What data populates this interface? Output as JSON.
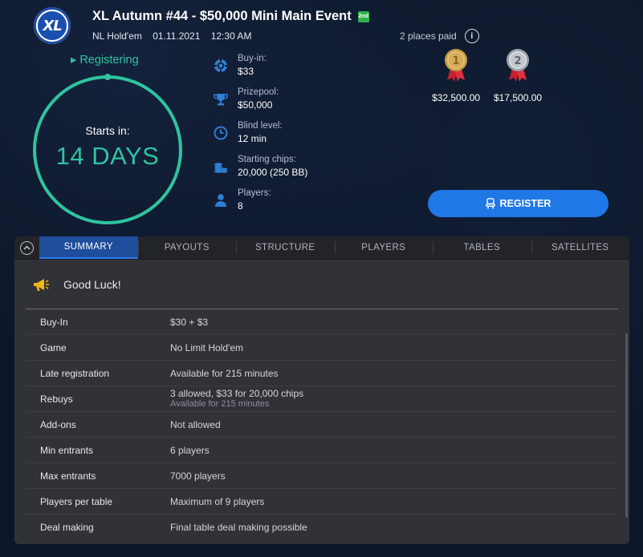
{
  "header": {
    "logo_text": "XL",
    "title": "XL Autumn #44 - $50,000 Mini Main Event",
    "badge": "2nd",
    "game": "NL Hold'em",
    "date": "01.11.2021",
    "time": "12:30 AM"
  },
  "status": {
    "label": "Registering",
    "countdown_label": "Starts in:",
    "countdown_value": "14 DAYS",
    "color": "#2ec4a0"
  },
  "info": [
    {
      "label": "Buy-in:",
      "value": "$33",
      "icon": "chip-icon"
    },
    {
      "label": "Prizepool:",
      "value": "$50,000",
      "icon": "trophy-icon"
    },
    {
      "label": "Blind level:",
      "value": "12 min",
      "icon": "clock-icon"
    },
    {
      "label": "Starting chips:",
      "value": "20,000 (250 BB)",
      "icon": "chip-stack-icon"
    },
    {
      "label": "Players:",
      "value": "8",
      "icon": "user-icon"
    }
  ],
  "places": {
    "text": "2 places paid",
    "prizes": [
      {
        "place": "1",
        "amount": "$32,500.00",
        "medal": "gold"
      },
      {
        "place": "2",
        "amount": "$17,500.00",
        "medal": "silver"
      }
    ]
  },
  "register_button": "REGISTER",
  "accent_color": "#1f78e6",
  "tabs": [
    {
      "label": "SUMMARY",
      "active": true
    },
    {
      "label": "PAYOUTS",
      "active": false
    },
    {
      "label": "STRUCTURE",
      "active": false
    },
    {
      "label": "PLAYERS",
      "active": false
    },
    {
      "label": "TABLES",
      "active": false
    },
    {
      "label": "SATELLITES",
      "active": false
    }
  ],
  "summary": {
    "message": "Good Luck!",
    "rows": [
      {
        "key": "Buy-In",
        "value": "$30 + $3"
      },
      {
        "key": "Game",
        "value": "No Limit Hold'em"
      },
      {
        "key": "Late registration",
        "value": "Available for 215 minutes"
      },
      {
        "key": "Rebuys",
        "value": "3 allowed, $33 for 20,000 chips",
        "sub": "Available for 215 minutes"
      },
      {
        "key": "Add-ons",
        "value": "Not allowed"
      },
      {
        "key": "Min entrants",
        "value": "6 players"
      },
      {
        "key": "Max entrants",
        "value": "7000 players"
      },
      {
        "key": "Players per table",
        "value": "Maximum of 9 players"
      },
      {
        "key": "Deal making",
        "value": "Final table deal making possible"
      }
    ]
  }
}
